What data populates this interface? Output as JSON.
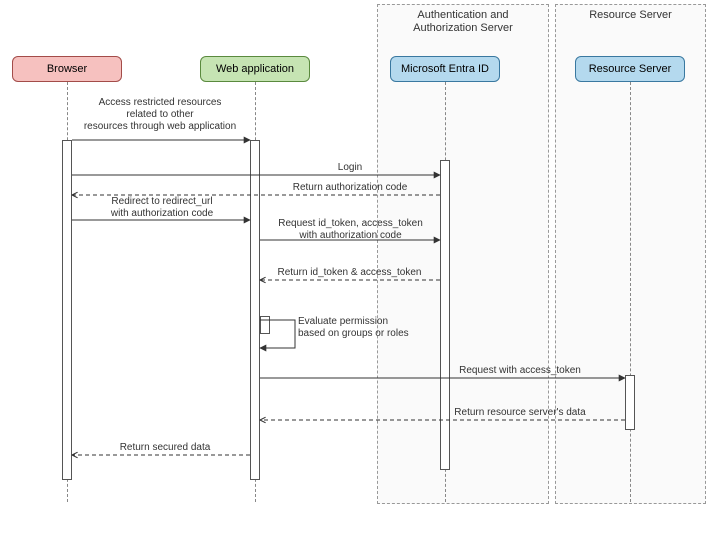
{
  "diagram": {
    "containers": {
      "auth": {
        "label": "Authentication and\nAuthorization Server"
      },
      "resource": {
        "label": "Resource Server"
      }
    },
    "participants": {
      "browser": "Browser",
      "webapp": "Web application",
      "entra": "Microsoft Entra ID",
      "resource": "Resource Server"
    },
    "messages": {
      "m1": "Access restricted resources\nrelated to other\nresources through web application",
      "m2": "Login",
      "m3": "Return authorization code",
      "m4": "Redirect to redirect_url\nwith authorization code",
      "m5": "Request id_token, access_token\nwith authorization code",
      "m6": "Return id_token & access_token",
      "m7": "Evaluate permission\nbased on groups or roles",
      "m8": "Request with access_token",
      "m9": "Return resource server's data",
      "m10": "Return secured data"
    }
  }
}
